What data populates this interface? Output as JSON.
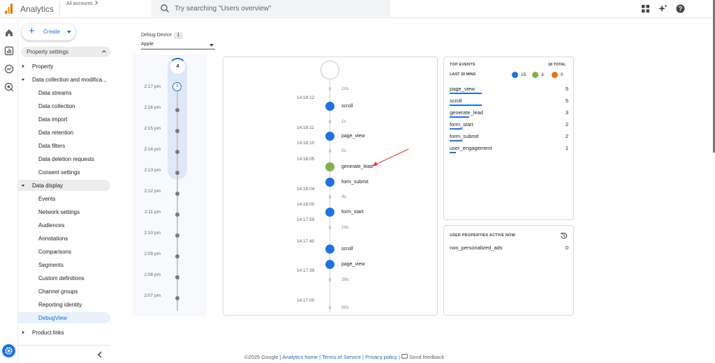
{
  "header": {
    "app_title": "Analytics",
    "accounts_label": "All accounts",
    "search_placeholder": "Try searching \"Users overview\""
  },
  "sidebar": {
    "create_label": "Create",
    "section_title": "Property settings",
    "items": [
      {
        "label": "Property",
        "level": 0,
        "expand": "collapsed"
      },
      {
        "label": "Data collection and modifica...",
        "level": 0,
        "expand": "expanded"
      },
      {
        "label": "Data streams",
        "level": 1
      },
      {
        "label": "Data collection",
        "level": 1
      },
      {
        "label": "Data import",
        "level": 1
      },
      {
        "label": "Data retention",
        "level": 1
      },
      {
        "label": "Data filters",
        "level": 1
      },
      {
        "label": "Data deletion requests",
        "level": 1
      },
      {
        "label": "Consent settings",
        "level": 1
      },
      {
        "label": "Data display",
        "level": 0,
        "expand": "expanded",
        "highlight": true
      },
      {
        "label": "Events",
        "level": 1
      },
      {
        "label": "Network settings",
        "level": 1
      },
      {
        "label": "Audiences",
        "level": 1
      },
      {
        "label": "Annotations",
        "level": 1
      },
      {
        "label": "Comparisons",
        "level": 1
      },
      {
        "label": "Segments",
        "level": 1
      },
      {
        "label": "Custom definitions",
        "level": 1
      },
      {
        "label": "Channel groups",
        "level": 1
      },
      {
        "label": "Reporting identity",
        "level": 1
      },
      {
        "label": "DebugView",
        "level": 1,
        "selected": true
      },
      {
        "label": "Product links",
        "level": 0,
        "expand": "collapsed"
      }
    ]
  },
  "debug_device": {
    "label": "Debug Device",
    "count": "1",
    "selected": "Apple"
  },
  "minutes_stream": {
    "top_count": "4",
    "current_count": "3",
    "times": [
      "2:17 pm",
      "2:16 pm",
      "2:15 pm",
      "2:14 pm",
      "2:13 pm",
      "2:12 pm",
      "2:11 pm",
      "2:10 pm",
      "2:09 pm",
      "2:08 pm",
      "2:07 pm"
    ]
  },
  "seconds_stream": {
    "timestamps": [
      "14:18:12",
      "14:18:11",
      "14:18:10",
      "14:18:05",
      "14:18:04",
      "14:18:00",
      "14:17:59",
      "14:17:40",
      "14:17:39",
      "14:17:00"
    ],
    "gaps": [
      "10s",
      "1s",
      "5s",
      "4s",
      "19s",
      "39s",
      "60s"
    ],
    "events": [
      {
        "name": "scroll",
        "type": "blue"
      },
      {
        "name": "page_view",
        "type": "blue"
      },
      {
        "name": "generate_lead",
        "type": "green"
      },
      {
        "name": "form_submit",
        "type": "blue"
      },
      {
        "name": "form_start",
        "type": "blue"
      },
      {
        "name": "scroll",
        "type": "blue"
      },
      {
        "name": "page_view",
        "type": "blue"
      }
    ]
  },
  "top_events": {
    "title": "TOP EVENTS",
    "total": "18 TOTAL",
    "subtitle": "LAST 30 MINS",
    "badges": {
      "blue": "15",
      "green": "3",
      "orange": "0"
    },
    "rows": [
      {
        "name": "page_view",
        "count": "5",
        "fraction": 1.0
      },
      {
        "name": "scroll",
        "count": "5",
        "fraction": 1.0
      },
      {
        "name": "generate_lead",
        "count": "3",
        "fraction": 0.6
      },
      {
        "name": "form_start",
        "count": "2",
        "fraction": 0.4
      },
      {
        "name": "form_submit",
        "count": "2",
        "fraction": 0.4
      },
      {
        "name": "user_engagement",
        "count": "1",
        "fraction": 0.2
      }
    ]
  },
  "user_properties": {
    "title": "USER PROPERTIES ACTIVE NOW",
    "rows": [
      {
        "name": "non_personalized_ads",
        "count": "0"
      }
    ]
  },
  "footer": {
    "copyright": "©2025 Google |",
    "home": "Analytics home",
    "sep1": "|",
    "terms": "Terms of Service",
    "sep2": "|",
    "privacy": "Privacy policy",
    "sep3": "|",
    "feedback": "Send feedback"
  },
  "colors": {
    "accent": "#1a73e8",
    "green": "#7cb342",
    "orange": "#e8710a",
    "arrow": "#e53935"
  }
}
